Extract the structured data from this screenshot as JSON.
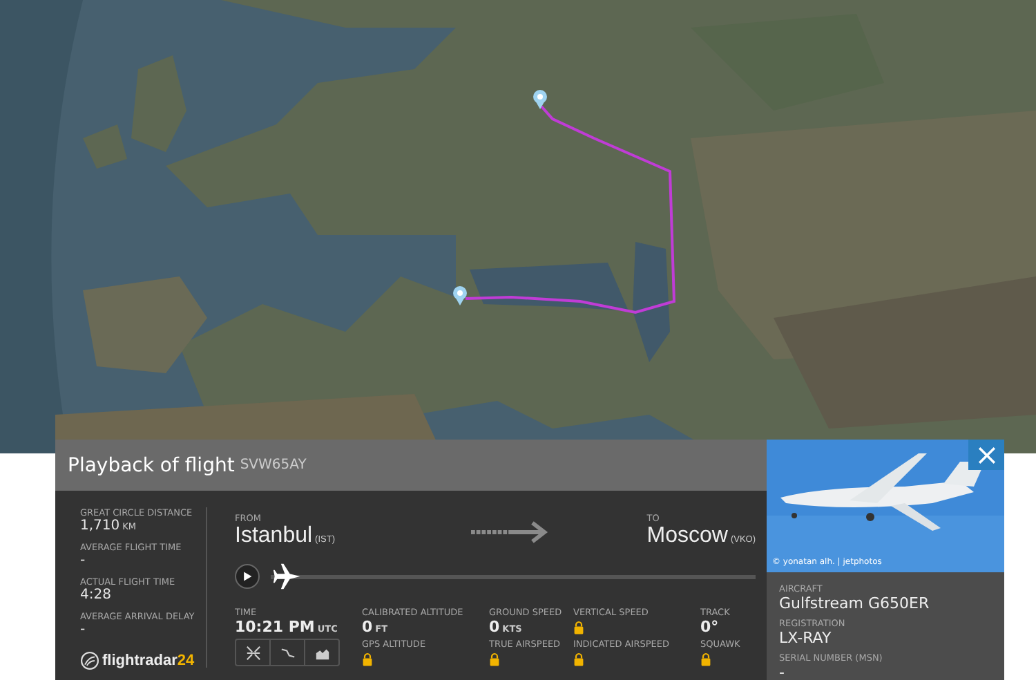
{
  "flight_panel": {
    "title": "Playback of flight",
    "callsign": "SVW65AY",
    "stats": [
      {
        "label": "GREAT CIRCLE DISTANCE",
        "value": "1,710",
        "unit": "KM"
      },
      {
        "label": "AVERAGE FLIGHT TIME",
        "value": "-"
      },
      {
        "label": "ACTUAL FLIGHT TIME",
        "value": "4:28"
      },
      {
        "label": "AVERAGE ARRIVAL DELAY",
        "value": "-"
      }
    ],
    "logo": {
      "text": "flightradar",
      "suffix": "24"
    },
    "from": {
      "label": "FROM",
      "city": "Istanbul",
      "code": "(IST)"
    },
    "to": {
      "label": "TO",
      "city": "Moscow",
      "code": "(VKO)"
    },
    "playback": {
      "level": 0
    },
    "time": {
      "label": "TIME",
      "value": "10:21 PM",
      "unit": "UTC"
    },
    "view_buttons": [
      {
        "kind": "expand"
      },
      {
        "kind": "route"
      },
      {
        "kind": "chart"
      }
    ],
    "metrics": [
      {
        "label": "CALIBRATED ALTITUDE",
        "kind": "value",
        "value": "0",
        "unit": "FT"
      },
      {
        "label": "GROUND SPEED",
        "kind": "value",
        "value": "0",
        "unit": "KTS"
      },
      {
        "label": "VERTICAL SPEED",
        "kind": "locked"
      },
      {
        "label": "TRACK",
        "kind": "value",
        "value": "0°"
      },
      {
        "label": "GPS ALTITUDE",
        "kind": "locked"
      },
      {
        "label": "TRUE AIRSPEED",
        "kind": "locked"
      },
      {
        "label": "INDICATED AIRSPEED",
        "kind": "locked"
      },
      {
        "label": "SQUAWK",
        "kind": "locked"
      }
    ]
  },
  "aircraft_card": {
    "photo_credit": "© yonatan alh. | jetphotos",
    "fields": [
      {
        "label": "AIRCRAFT",
        "value": "Gulfstream G650ER"
      },
      {
        "label": "REGISTRATION",
        "value": "LX-RAY"
      },
      {
        "label": "SERIAL NUMBER (MSN)",
        "value": "-"
      }
    ]
  }
}
